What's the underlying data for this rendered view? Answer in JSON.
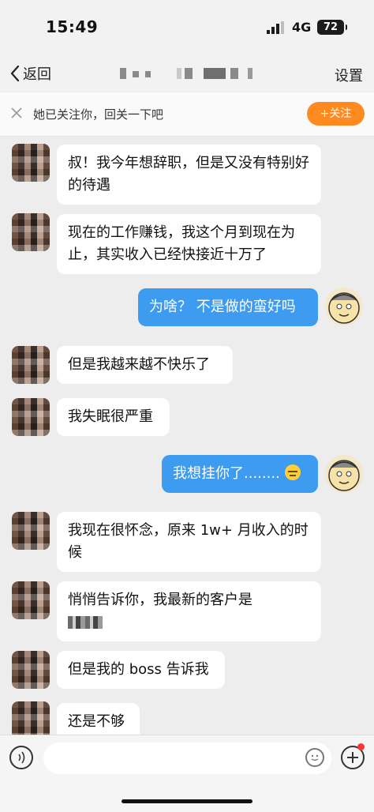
{
  "status": {
    "time": "15:49",
    "network": "4G",
    "battery": "72"
  },
  "nav": {
    "back_label": "返回",
    "settings_label": "设置"
  },
  "follow": {
    "text": "她已关注你，回关一下吧",
    "button_label": "+关注"
  },
  "messages": [
    {
      "side": "in",
      "text": "叔！我今年想辞职，但是又没有特别好的待遇"
    },
    {
      "side": "in",
      "text": "现在的工作赚钱，我这个月到现在为止，其实收入已经快接近十万了"
    },
    {
      "side": "out",
      "text": "为啥？ 不是做的蛮好吗"
    },
    {
      "side": "in",
      "text": "但是我越来越不快乐了"
    },
    {
      "side": "in",
      "text": "我失眠很严重"
    },
    {
      "side": "out",
      "text": "我想挂你了........"
    },
    {
      "side": "in",
      "text": "我现在很怀念，原来 1w+ 月收入的时候"
    },
    {
      "side": "in",
      "text": "悄悄告诉你，我最新的客户是"
    },
    {
      "side": "in",
      "text": "但是我的 boss 告诉我"
    },
    {
      "side": "in",
      "text": "还是不够"
    }
  ],
  "colors": {
    "accent_orange": "#ff8a1f",
    "bubble_out": "#3d9bf0",
    "bubble_in": "#ffffff",
    "background": "#ededed"
  },
  "icons": [
    "chevron-left-icon",
    "close-icon",
    "voice-icon",
    "emoji-icon",
    "plus-icon"
  ]
}
